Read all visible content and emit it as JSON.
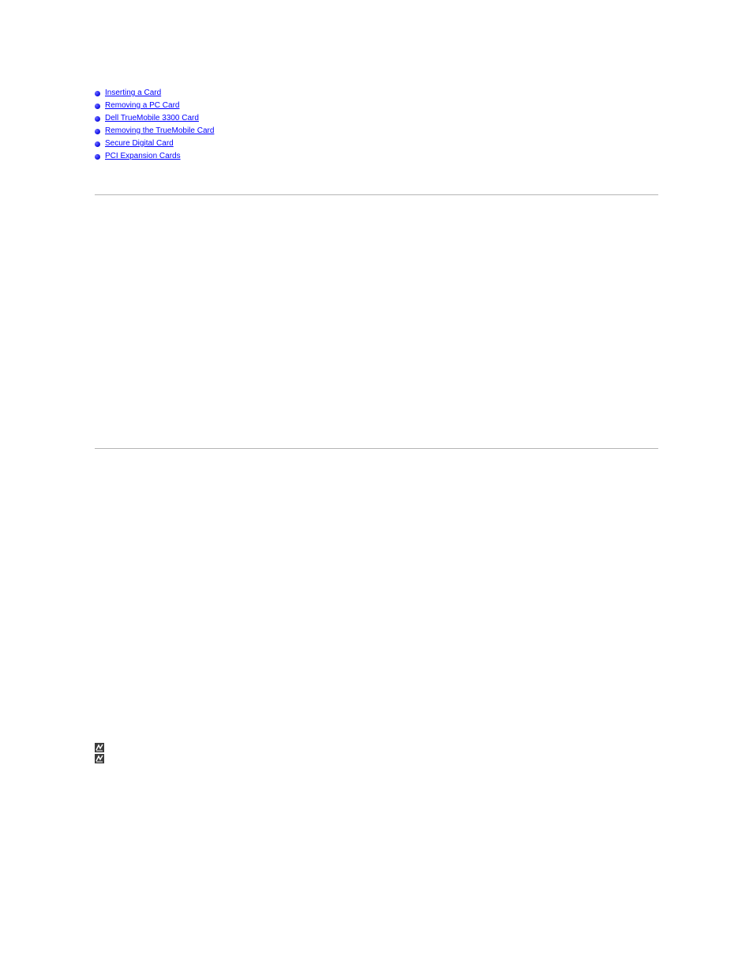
{
  "toc": {
    "items": [
      {
        "label": "Inserting a Card"
      },
      {
        "label": "Removing a PC Card"
      },
      {
        "label": "Dell TrueMobile 3300 Card"
      },
      {
        "label": "Removing the TrueMobile Card"
      },
      {
        "label": "Secure Digital Card"
      },
      {
        "label": "PCI Expansion Cards"
      }
    ]
  },
  "notes": {
    "note1": "",
    "note2": ""
  }
}
